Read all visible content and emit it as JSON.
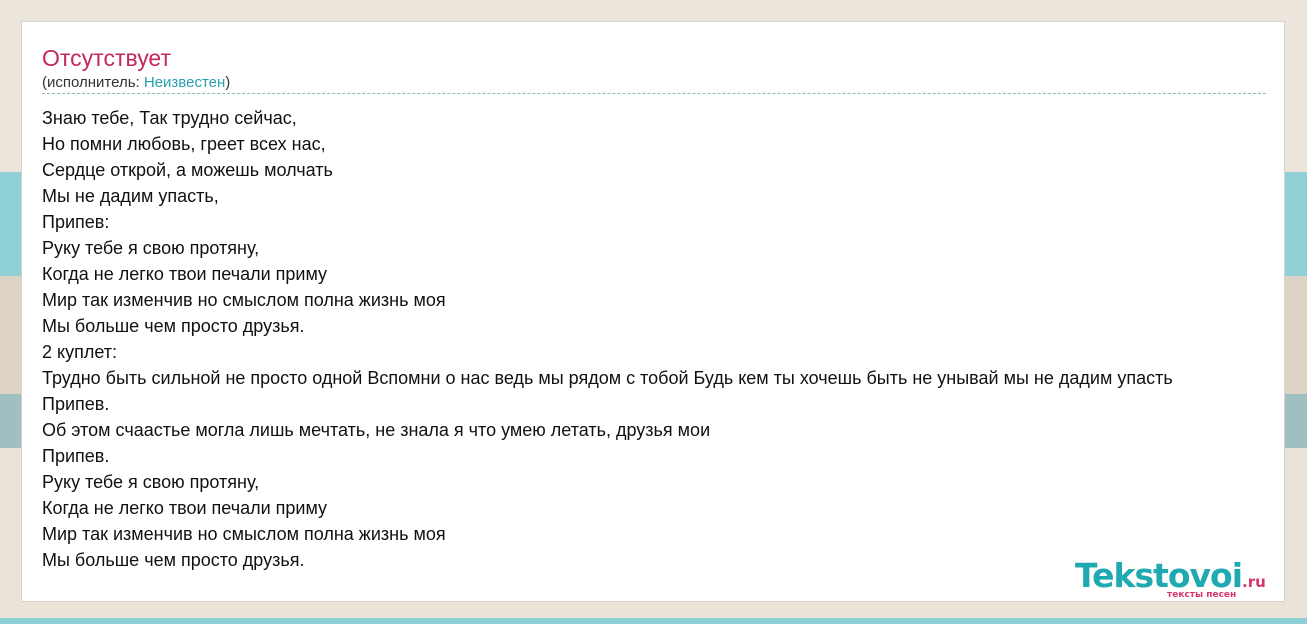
{
  "song": {
    "title": "Отсутствует",
    "artist_prefix": "(исполнитель: ",
    "artist": "Неизвестен",
    "artist_suffix": ")"
  },
  "lyrics": [
    "Знаю тебе, Так трудно сейчас,",
    "Но помни любовь, греет всех нас,",
    "Сердце открой, а можешь молчать",
    "Мы не дадим упасть,",
    "Припев:",
    "Руку тебе я свою протяну,",
    "Когда не легко твои печали приму",
    "Мир так изменчив но смыслом полна жизнь моя",
    "Мы больше чем просто друзья.",
    "2 куплет:",
    "Трудно быть сильной не просто одной Вспомни о нас ведь мы рядом с тобой Будь кем ты хочешь быть не унывай мы не дадим упасть",
    "Припев.",
    "Об этом счаастье могла лишь мечтать, не знала я что умею летать, друзья мои",
    "Припев.",
    "Руку тебе я свою протяну,",
    "Когда не легко твои печали приму",
    "Мир так изменчив но смыслом полна жизнь моя",
    "Мы больше чем просто друзья."
  ],
  "logo": {
    "name": "Tekstovoi",
    "tld": ".ru",
    "tagline": "тексты песен"
  },
  "colors": {
    "title": "#c4285c",
    "link": "#2a9fb0",
    "logo_main": "#1eaab0",
    "logo_accent": "#d9346b"
  }
}
